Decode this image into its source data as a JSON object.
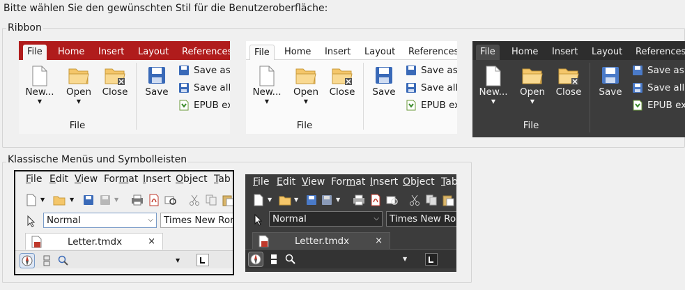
{
  "prompt": "Bitte wählen Sie den gewünschten Stil für die Benutzeroberfläche:",
  "ribbon_group": {
    "title": "Ribbon",
    "tabs": [
      "File",
      "Home",
      "Insert",
      "Layout",
      "References"
    ],
    "buttons": {
      "new": "New...",
      "open": "Open",
      "close": "Close",
      "save": "Save"
    },
    "small": {
      "save_as": "Save as",
      "save_all": "Save all",
      "epub": "EPUB ex"
    },
    "group_label": "File",
    "accent": "#b01c1c"
  },
  "classic_group": {
    "title": "Klassische Menüs und Symbolleisten",
    "menu": [
      {
        "label": "File",
        "u": "F",
        "rest": "ile"
      },
      {
        "label": "Edit",
        "u": "E",
        "rest": "dit"
      },
      {
        "label": "View",
        "u": "V",
        "rest": "iew"
      },
      {
        "label": "Format",
        "pre": "For",
        "u": "m",
        "rest": "at"
      },
      {
        "label": "Insert",
        "u": "I",
        "rest": "nsert"
      },
      {
        "label": "Object",
        "u": "O",
        "rest": "bject"
      },
      {
        "label": "Table",
        "u": "T",
        "rest": "ab"
      }
    ],
    "style_combo": "Normal",
    "font_combo": "Times New Roman",
    "doc_tab": "Letter.tmdx",
    "close_symbol": "×"
  }
}
